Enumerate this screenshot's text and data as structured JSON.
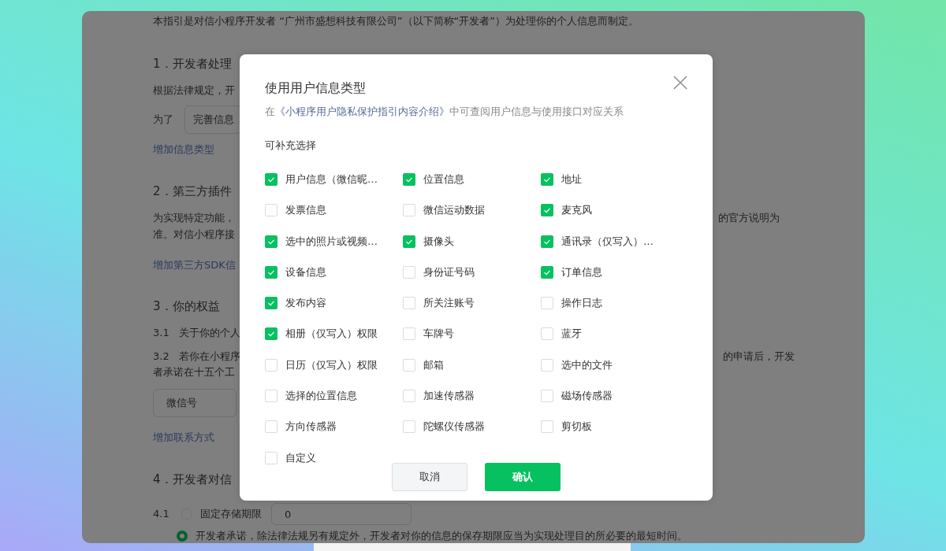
{
  "page": {
    "intro": "本指引是对信小程序开发者 “广州市盛想科技有限公司”（以下简称“开发者”）为处理你的个人信息而制定。",
    "section_1": {
      "heading": "1．开发者处理",
      "text": "根据法律规定，开",
      "purpose_label": "为了",
      "purpose_field": "完善信息",
      "add_link": "增加信息类型"
    },
    "section_2": {
      "heading": "2．第三方插件",
      "text_left": "为实现特定功能，",
      "text_right": "的官方说明为",
      "text_line_2": "准。对信小程序接",
      "add_link": "增加第三方SDK信"
    },
    "section_3": {
      "heading": "3．你的权益",
      "item_1": "3.1   关于你的个人",
      "item_2_left": "3.2   若你在小程序",
      "item_2_right": "的申请后，开发",
      "item_2_line_2": "者承诺在十五个工",
      "contact_field": "微信号",
      "add_link": "增加联系方式"
    },
    "section_4": {
      "heading": "4．开发者对信",
      "number": "4.1",
      "options": [
        {
          "label": "固定存储期限",
          "selected": false,
          "value": "0"
        },
        {
          "label": "开发者承诺，除法律法规另有规定外，开发者对你的信息的保存期限应当为实现处理目的所必要的最短时间。",
          "selected": true
        }
      ]
    }
  },
  "dialog": {
    "title": "使用用户信息类型",
    "hint_before": "在",
    "hint_link": "《小程序用户隐私保护指引内容介绍》",
    "hint_after": "中可查阅用户信息与使用接口对应关系",
    "section_label": "可补充选择",
    "options": [
      {
        "label": "用户信息（微信昵…",
        "checked": true
      },
      {
        "label": "位置信息",
        "checked": true
      },
      {
        "label": "地址",
        "checked": true
      },
      {
        "label": "发票信息",
        "checked": false
      },
      {
        "label": "微信运动数据",
        "checked": false
      },
      {
        "label": "麦克风",
        "checked": true
      },
      {
        "label": "选中的照片或视频…",
        "checked": true
      },
      {
        "label": "摄像头",
        "checked": true
      },
      {
        "label": "通讯录（仅写入）…",
        "checked": true
      },
      {
        "label": "设备信息",
        "checked": true
      },
      {
        "label": "身份证号码",
        "checked": false
      },
      {
        "label": "订单信息",
        "checked": true
      },
      {
        "label": "发布内容",
        "checked": true
      },
      {
        "label": "所关注账号",
        "checked": false
      },
      {
        "label": "操作日志",
        "checked": false
      },
      {
        "label": "相册（仅写入）权限",
        "checked": true
      },
      {
        "label": "车牌号",
        "checked": false
      },
      {
        "label": "蓝牙",
        "checked": false
      },
      {
        "label": "日历（仅写入）权限",
        "checked": false
      },
      {
        "label": "邮箱",
        "checked": false
      },
      {
        "label": "选中的文件",
        "checked": false
      },
      {
        "label": "选择的位置信息",
        "checked": false
      },
      {
        "label": "加速传感器",
        "checked": false
      },
      {
        "label": "磁场传感器",
        "checked": false
      },
      {
        "label": "方向传感器",
        "checked": false
      },
      {
        "label": "陀螺仪传感器",
        "checked": false
      },
      {
        "label": "剪切板",
        "checked": false
      },
      {
        "label": "自定义",
        "checked": false
      }
    ],
    "buttons": [
      {
        "label": "取消",
        "kind": "secondary"
      },
      {
        "label": "确认",
        "kind": "primary"
      }
    ]
  }
}
